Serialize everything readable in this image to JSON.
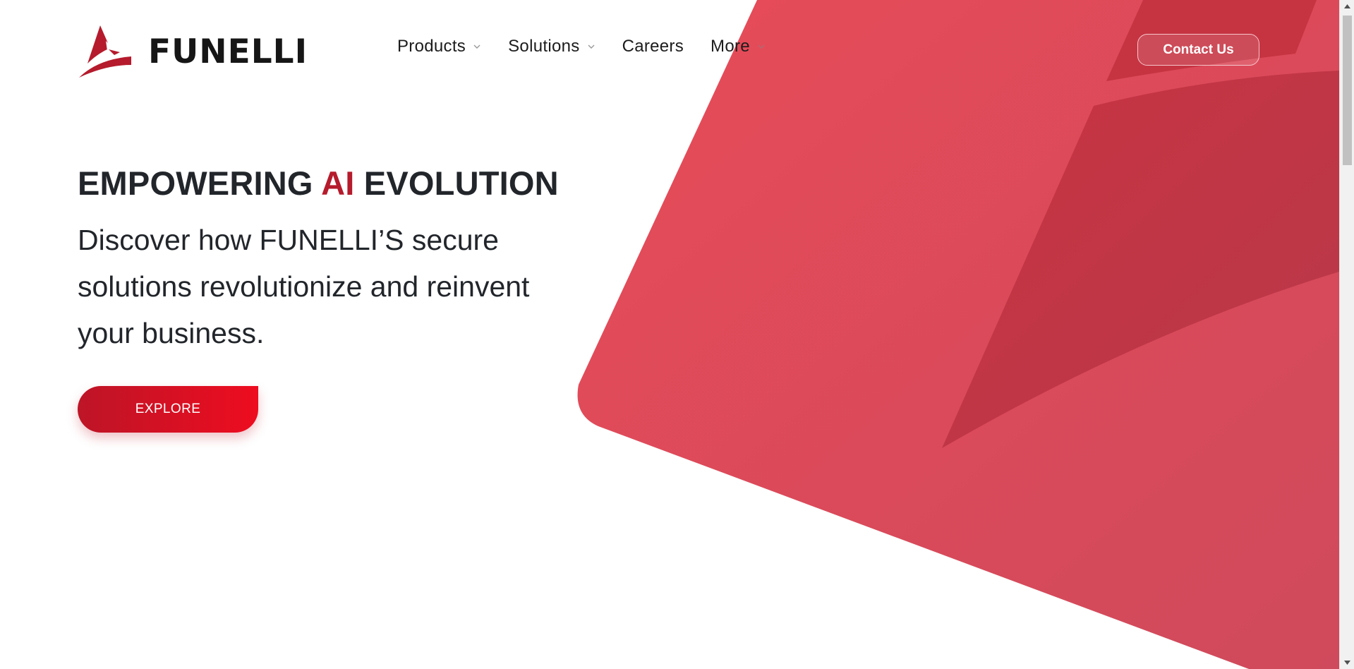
{
  "brand": {
    "name": "FUNELLI",
    "primary_color": "#b51b2c",
    "accent_color": "#e84b58"
  },
  "nav": {
    "items": [
      {
        "label": "Products",
        "has_dropdown": true
      },
      {
        "label": "Solutions",
        "has_dropdown": true
      },
      {
        "label": "Careers",
        "has_dropdown": false
      },
      {
        "label": "More",
        "has_dropdown": true
      }
    ],
    "contact_label": "Contact Us"
  },
  "hero": {
    "title_part1": "EMPOWERING ",
    "title_accent": "AI",
    "title_part2": " EVOLUTION",
    "subtitle": "Discover how FUNELLI’S secure solutions revolutionize and reinvent your business.",
    "cta_label": "EXPLORE"
  },
  "icons": {
    "logo": "funelli-logo-icon",
    "dropdown": "chevron-down-icon",
    "scroll_up": "arrow-up-icon",
    "scroll_down": "arrow-down-icon"
  }
}
